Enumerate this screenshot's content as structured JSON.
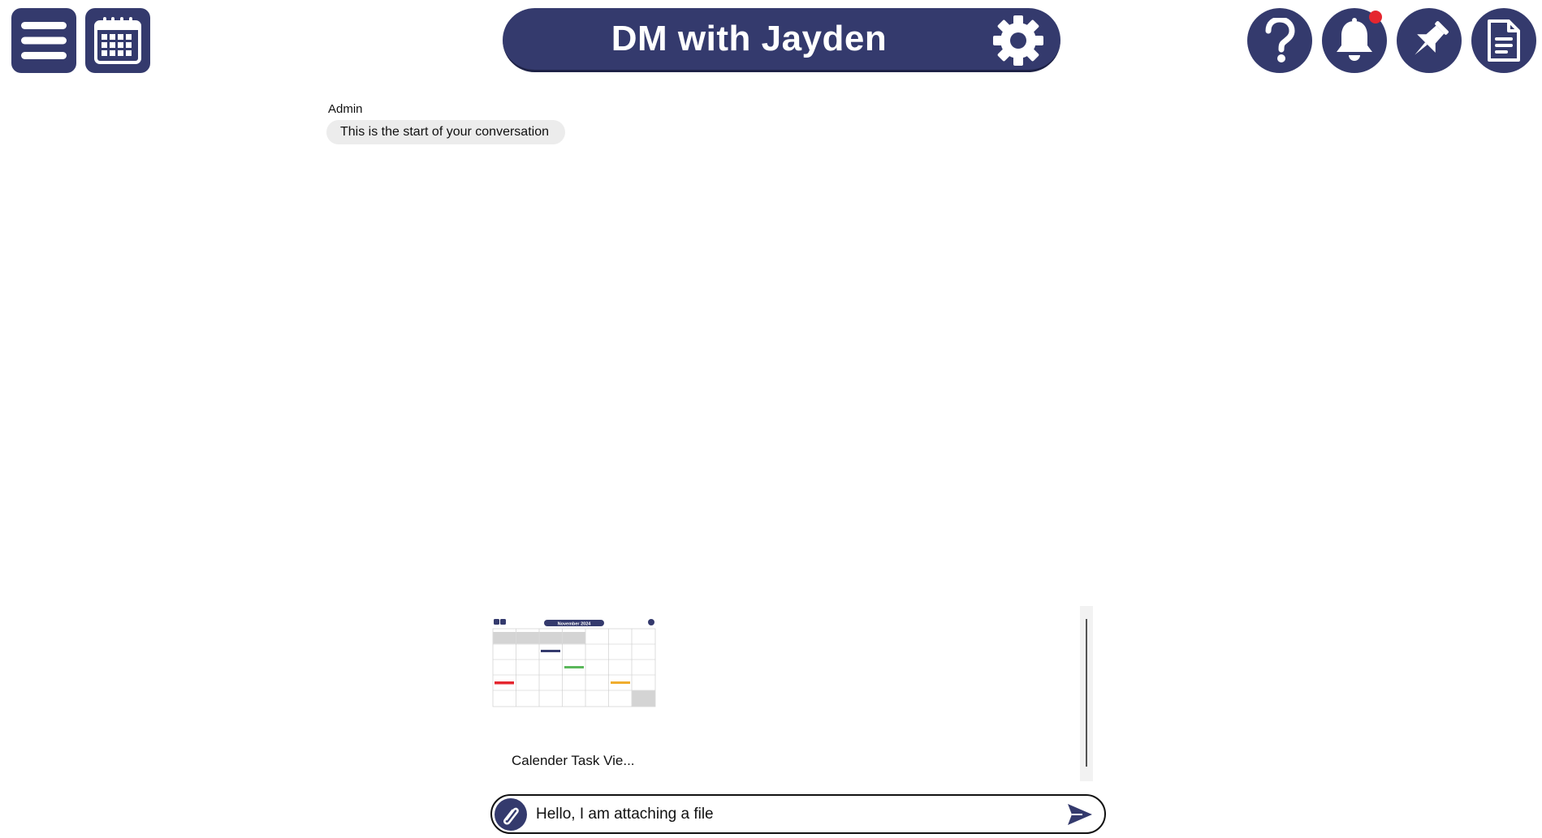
{
  "header": {
    "title": "DM with Jayden",
    "left_buttons": [
      {
        "name": "menu",
        "icon": "hamburger-icon"
      },
      {
        "name": "calendar",
        "icon": "calendar-icon"
      }
    ],
    "right_buttons": [
      {
        "name": "help",
        "icon": "question-icon"
      },
      {
        "name": "notifications",
        "icon": "bell-icon",
        "has_unread": true
      },
      {
        "name": "pins",
        "icon": "pin-icon"
      },
      {
        "name": "notes",
        "icon": "document-icon"
      }
    ],
    "settings_icon": "gear-icon"
  },
  "messages": [
    {
      "sender": "Admin",
      "text": "This is the start of your conversation"
    }
  ],
  "attachments": [
    {
      "file_name": "Calender Task Vie...",
      "thumb_title": "November 2024"
    }
  ],
  "composer": {
    "value": "Hello, I am attaching a file",
    "attach_icon": "paperclip-icon",
    "send_icon": "send-icon"
  },
  "colors": {
    "primary": "#343a6d",
    "bubble": "#ececec",
    "notification_dot": "#e5262f"
  }
}
